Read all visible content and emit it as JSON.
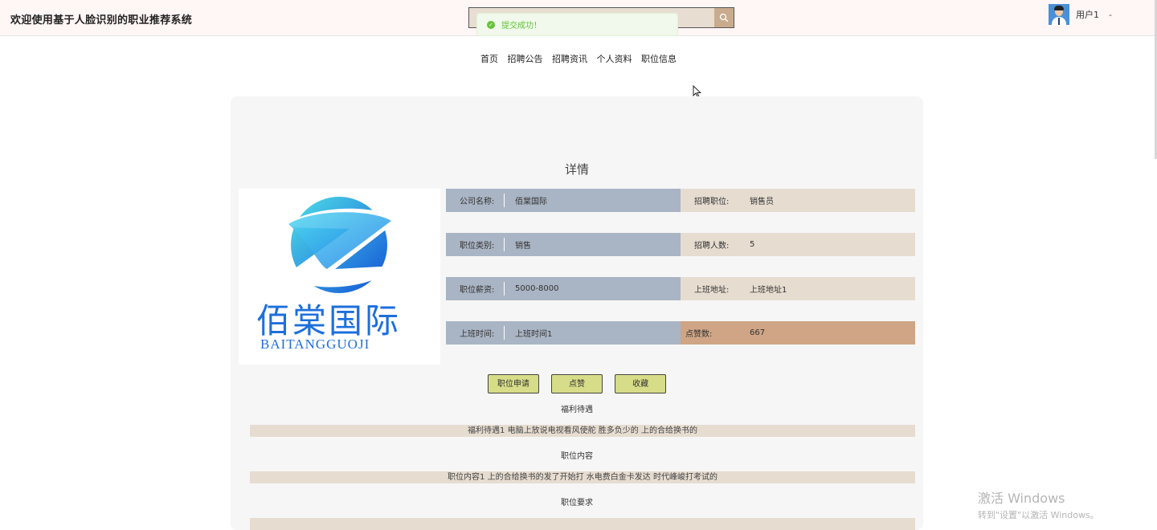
{
  "header": {
    "title": "欢迎使用基于人脸识别的职业推荐系统",
    "search_placeholder": "",
    "user_name": "用户1",
    "user_caret": "-"
  },
  "toast": {
    "message": "提交成功！"
  },
  "nav": {
    "items": [
      "首页",
      "招聘公告",
      "招聘资讯",
      "个人资料",
      "职位信息"
    ]
  },
  "detail": {
    "title": "详情",
    "logo": {
      "cn": "佰棠国际",
      "en": "BAITANGGUOJI"
    },
    "fields_left": [
      {
        "label": "公司名称:",
        "value": "佰棠国际"
      },
      {
        "label": "职位类别:",
        "value": "销售"
      },
      {
        "label": "职位薪资:",
        "value": "5000-8000"
      },
      {
        "label": "上班时间:",
        "value": "上班时间1"
      }
    ],
    "fields_right": [
      {
        "label": "招聘职位:",
        "value": "销售员"
      },
      {
        "label": "招聘人数:",
        "value": "5"
      },
      {
        "label": "上班地址:",
        "value": "上班地址1"
      },
      {
        "label": "点赞数:",
        "value": "667"
      }
    ],
    "buttons": {
      "apply": "职位申请",
      "like": "点赞",
      "favorite": "收藏"
    },
    "sections": [
      {
        "title": "福利待遇",
        "content": "福利待遇1 电脑上放说电视看风使舵 胜多负少的 上的合给换书的"
      },
      {
        "title": "职位内容",
        "content": "职位内容1 上的合给换书的发了开始打 水电费白金卡发达 时代峰峻打考试的"
      },
      {
        "title": "职位要求",
        "content": ""
      }
    ]
  },
  "watermark": {
    "line1": "激活 Windows",
    "line2": "转到\"设置\"以激活 Windows。"
  }
}
